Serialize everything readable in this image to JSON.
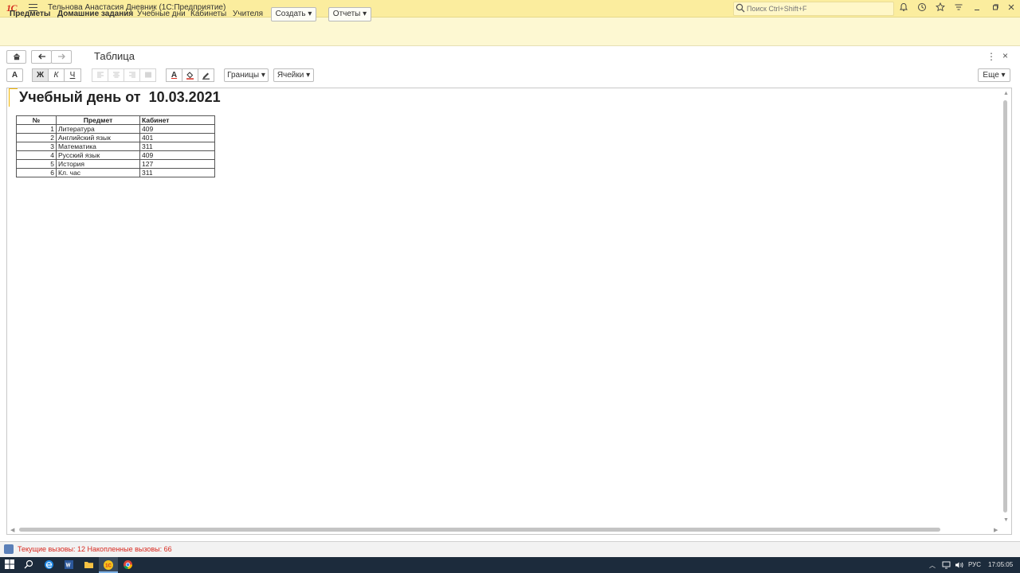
{
  "window": {
    "logo": "1С",
    "title": "Тельнова Анастасия Дневник  (1С:Предприятие)",
    "search_placeholder": "Поиск Ctrl+Shift+F"
  },
  "sections": {
    "items": [
      "Предметы",
      "Домашние задания",
      "Учебные дни",
      "Кабинеты",
      "Учителя"
    ],
    "create_label": "Создать",
    "reports_label": "Отчеты"
  },
  "form": {
    "title": "Таблица",
    "more_label": "Еще",
    "borders_label": "Границы",
    "cells_label": "Ячейки",
    "font_label": "A",
    "bold_label": "Ж",
    "italic_label": "К",
    "underline_label": "Ч",
    "text_color_label": "A"
  },
  "document": {
    "heading": "Учебный день от  10.03.2021",
    "columns": [
      "№",
      "Предмет",
      "Кабинет"
    ],
    "rows": [
      {
        "num": "1",
        "subject": "Литература",
        "room": "409"
      },
      {
        "num": "2",
        "subject": "Английский язык",
        "room": "401"
      },
      {
        "num": "3",
        "subject": "Математика",
        "room": "311"
      },
      {
        "num": "4",
        "subject": "Русский язык",
        "room": "409"
      },
      {
        "num": "5",
        "subject": "История",
        "room": "127"
      },
      {
        "num": "6",
        "subject": "Кл. час",
        "room": "311"
      }
    ]
  },
  "status": {
    "text": "Текущие вызовы: 12   Накопленные вызовы: 66"
  },
  "taskbar": {
    "language": "РУС",
    "time": "17:05:05"
  },
  "colors": {
    "titlebar": "#fbed9e",
    "sections_panel": "#fdf8d2",
    "status_text": "#d8281e",
    "taskbar": "#1c2b3c"
  }
}
